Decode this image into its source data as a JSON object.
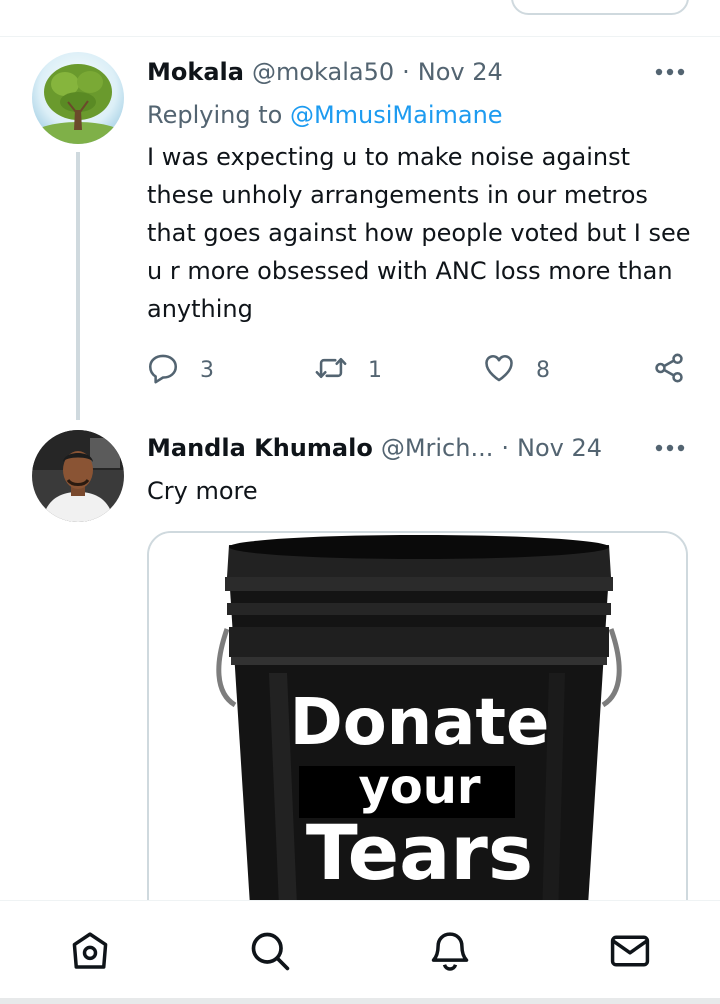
{
  "tweets": [
    {
      "name": "Mokala",
      "handle": "@mokala50",
      "date": "Nov 24",
      "replying_to_label": "Replying to",
      "replying_to_handle": "@MmusiMaimane",
      "text": "I was expecting u to make noise against these unholy arrangements in our metros that goes against how people voted but I see u r more obsessed with ANC loss more than anything",
      "stats": {
        "replies": "3",
        "retweets": "1",
        "likes": "8"
      }
    },
    {
      "name": "Mandla Khumalo",
      "handle": "@Mrich...",
      "date": "Nov 24",
      "text": "Cry more",
      "media": {
        "image_text_line1": "Donate",
        "image_text_line2": "your",
        "image_text_line3": "Tears"
      }
    }
  ],
  "separator": "·",
  "icons": {
    "more": "more-dots-icon",
    "reply": "reply-bubble-icon",
    "retweet": "retweet-icon",
    "like": "heart-icon",
    "share": "share-icon",
    "home": "home-icon",
    "search": "search-icon",
    "notifications": "bell-icon",
    "messages": "envelope-icon"
  },
  "colors": {
    "accent": "#1d9bf0",
    "text_primary": "#0f1419",
    "text_secondary": "#536471",
    "border": "#cfd9de"
  }
}
